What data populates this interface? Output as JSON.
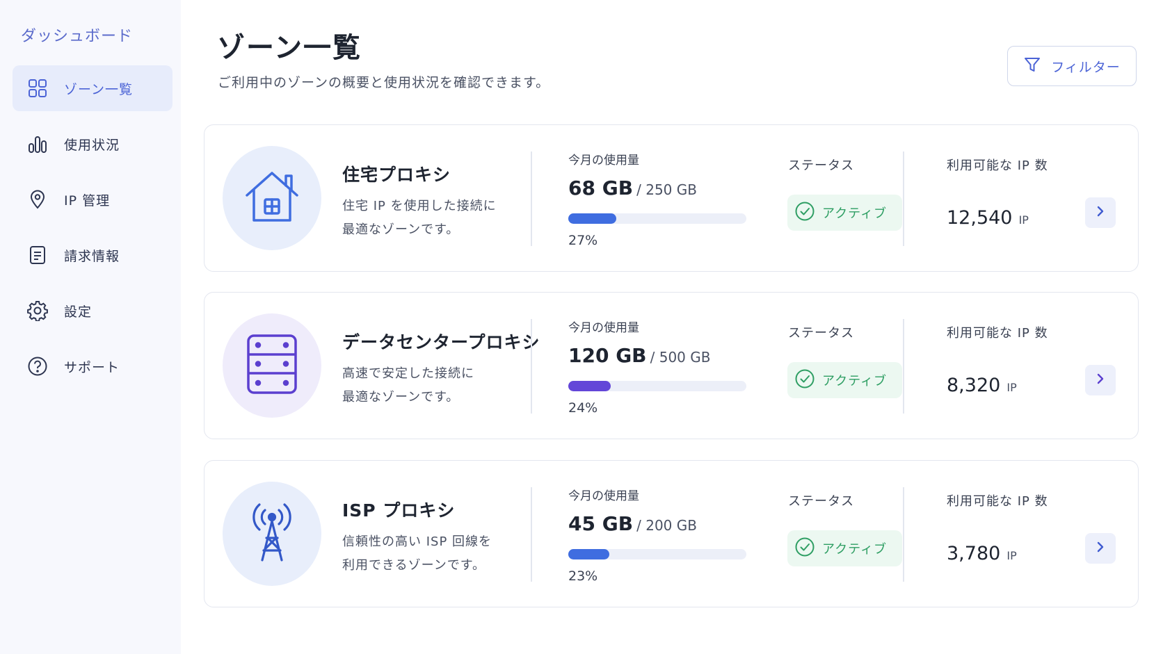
{
  "sidebar": {
    "title": "ダッシュボード",
    "items": [
      {
        "label": "ゾーン一覧",
        "icon": "grid-icon",
        "active": true
      },
      {
        "label": "使用状況",
        "icon": "bar-chart-icon"
      },
      {
        "label": "IP 管理",
        "icon": "location-pin-icon"
      },
      {
        "label": "請求情報",
        "icon": "document-icon"
      },
      {
        "label": "設定",
        "icon": "gear-icon"
      },
      {
        "label": "サポート",
        "icon": "help-circle-icon"
      }
    ]
  },
  "header": {
    "title": "ゾーン一覧",
    "subtitle": "ご利用中のゾーンの概要と使用状況を確認できます。",
    "filter_label": "フィルター"
  },
  "zones": [
    {
      "name": "住宅プロキシ",
      "desc_line1": "住宅 IP を使用した接続に",
      "desc_line2": "最適なゾーンです。",
      "icon": "house-icon",
      "usage_label": "今月の使用量",
      "usage_used": "68 GB",
      "usage_total": "/ 250 GB",
      "usage_fraction": 0.27,
      "usage_pct": "27%",
      "bar_color": "#3f6de0",
      "status_label": "ステータス",
      "status": "アクティブ",
      "ip_label": "利用可能な IP 数",
      "ip_count": "12,540",
      "ip_unit": "IP"
    },
    {
      "name": "データセンタープロキシ",
      "desc_line1": "高速で安定した接続に",
      "desc_line2": "最適なゾーンです。",
      "icon": "server-icon",
      "usage_label": "今月の使用量",
      "usage_used": "120 GB",
      "usage_total": "/ 500 GB",
      "usage_fraction": 0.24,
      "usage_pct": "24%",
      "bar_color": "#6346d8",
      "status_label": "ステータス",
      "status": "アクティブ",
      "ip_label": "利用可能な IP 数",
      "ip_count": "8,320",
      "ip_unit": "IP"
    },
    {
      "name": "ISP プロキシ",
      "desc_line1": "信頼性の高い ISP 回線を",
      "desc_line2": "利用できるゾーンです。",
      "icon": "antenna-tower-icon",
      "usage_label": "今月の使用量",
      "usage_used": "45 GB",
      "usage_total": "/ 200 GB",
      "usage_fraction": 0.23,
      "usage_pct": "23%",
      "bar_color": "#3f6de0",
      "status_label": "ステータス",
      "status": "アクティブ",
      "ip_label": "利用可能な IP 数",
      "ip_count": "3,780",
      "ip_unit": "IP"
    }
  ],
  "colors": {
    "accent": "#4b63d6",
    "success": "#2e9e63",
    "sidebar_bg": "#f7f8fd"
  }
}
